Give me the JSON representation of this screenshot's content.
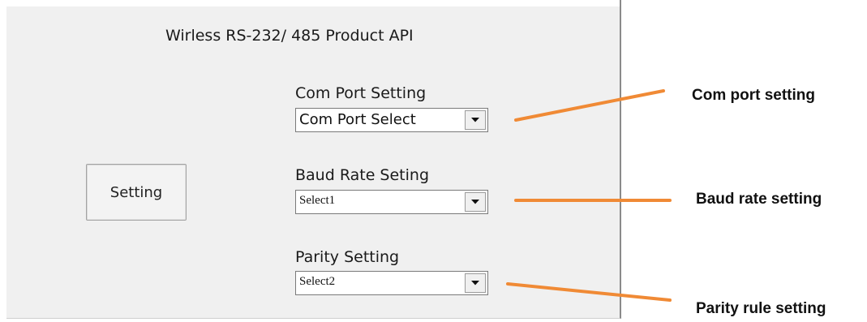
{
  "app": {
    "title": "Wirless RS-232/ 485 Product API",
    "setting_button_label": "Setting"
  },
  "fields": [
    {
      "label": "Com Port Setting",
      "value": "Com Port Select"
    },
    {
      "label": "Baud Rate Seting",
      "value": "Select1"
    },
    {
      "label": "Parity Setting",
      "value": "Select2"
    }
  ],
  "annotations": [
    {
      "text": "Com port setting"
    },
    {
      "text": "Baud rate setting"
    },
    {
      "text": "Parity rule setting"
    }
  ],
  "colors": {
    "window_background": "#f0f0f0",
    "annotation_line": "#f08a35",
    "window_border": "#8a8a8a"
  },
  "icons": {
    "dropdown": "chevron-down-icon"
  }
}
